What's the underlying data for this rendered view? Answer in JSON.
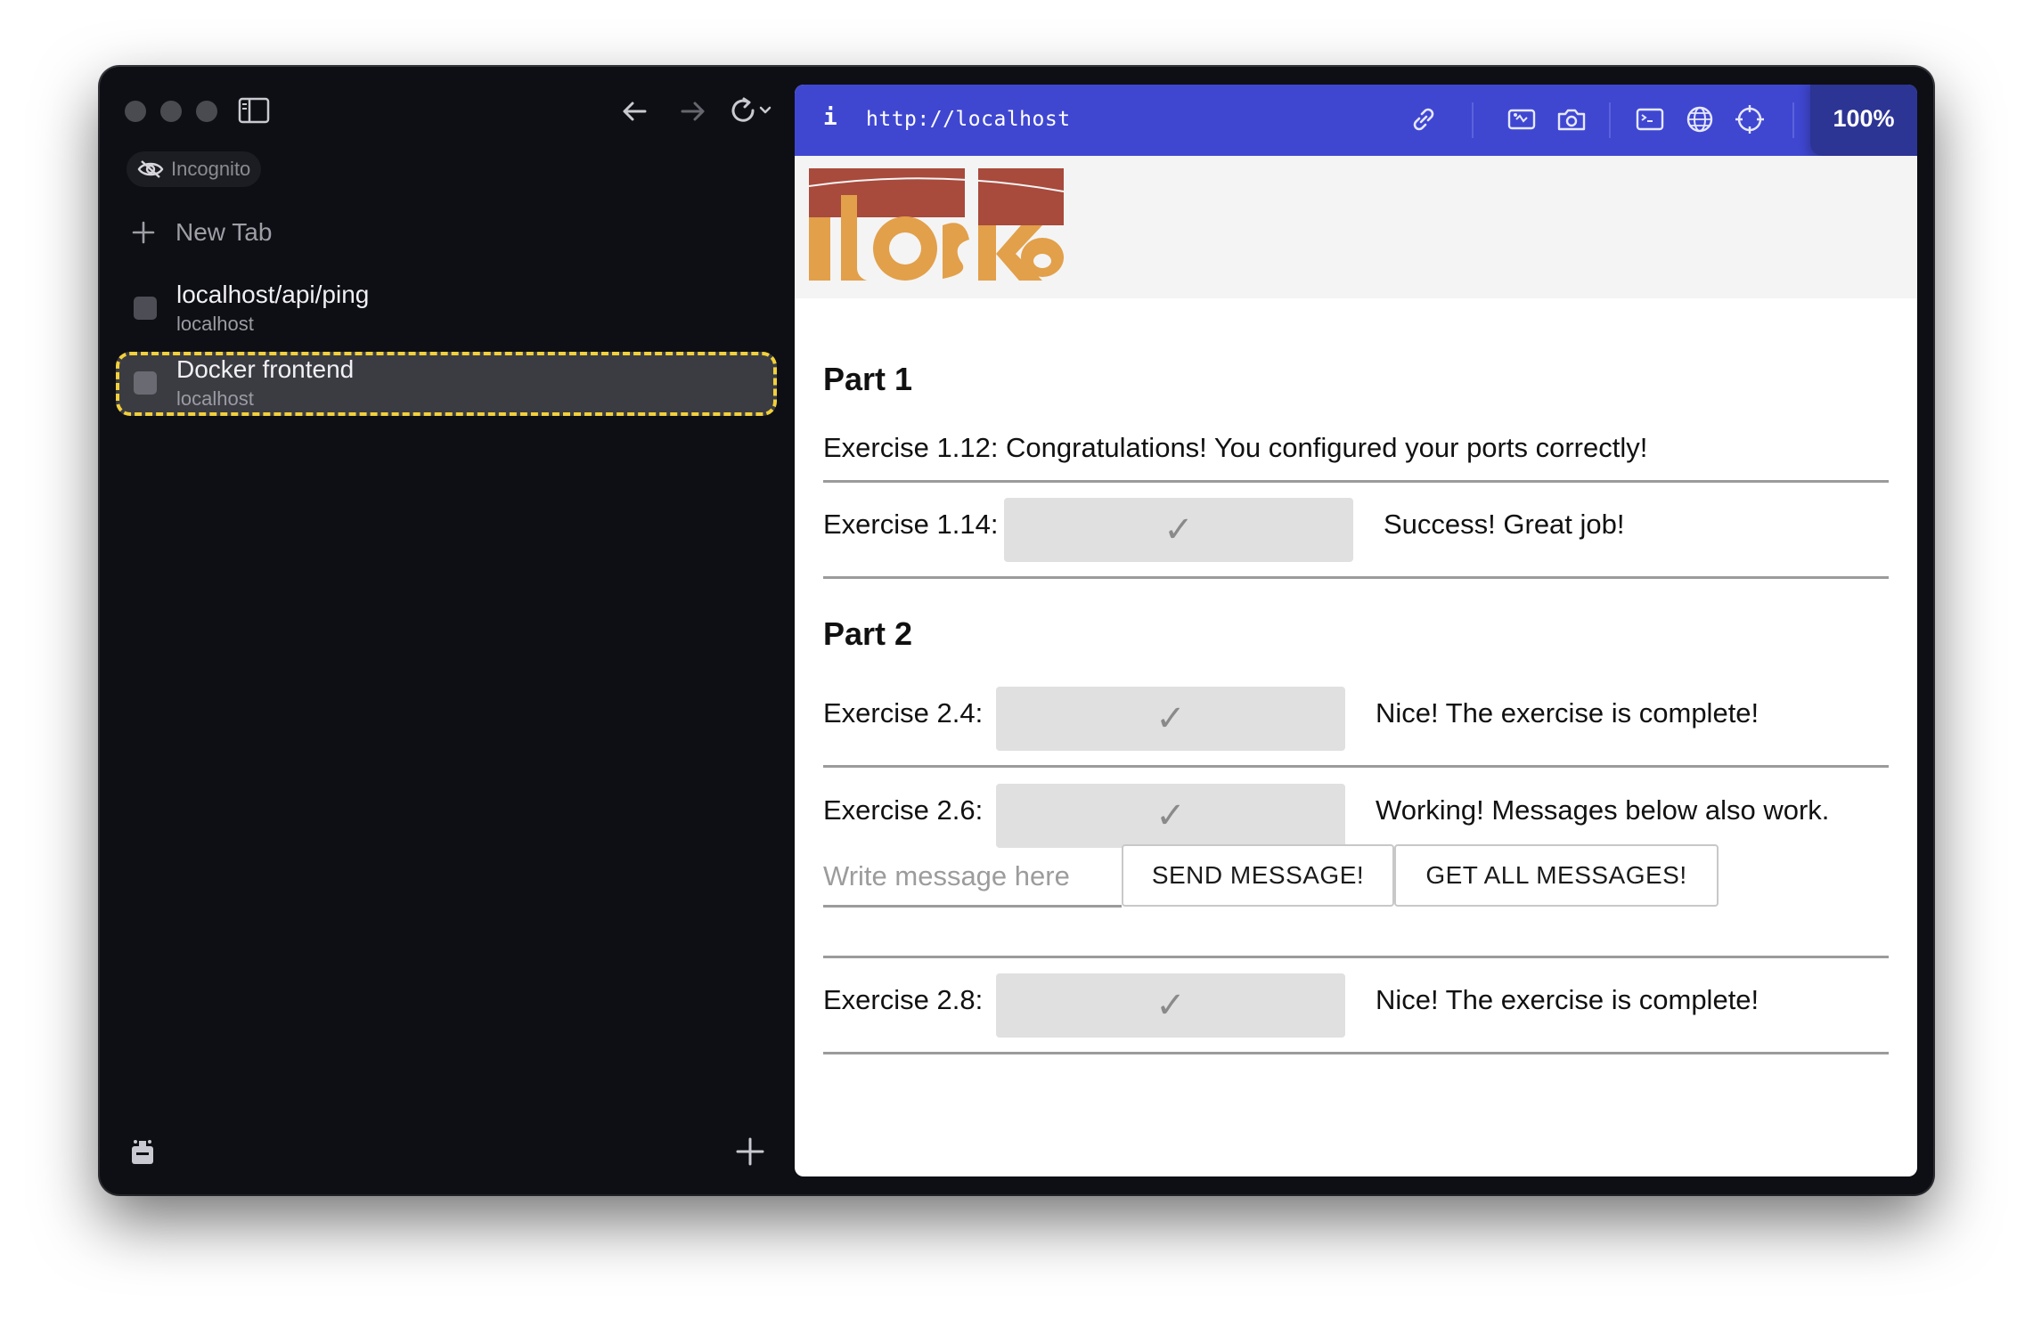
{
  "sidebar": {
    "incognito_label": "Incognito",
    "new_tab_label": "New Tab",
    "tabs": [
      {
        "title": "localhost/api/ping",
        "subtitle": "localhost"
      },
      {
        "title": "Docker frontend",
        "subtitle": "localhost"
      }
    ]
  },
  "toolbar": {
    "info_glyph": "i",
    "url": "http://localhost",
    "zoom": "100%",
    "accent_color": "#3f47d1"
  },
  "page": {
    "part1": {
      "title": "Part 1",
      "ex112": "Exercise 1.12: Congratulations! You configured your ports correctly!",
      "ex114_label": "Exercise 1.14:",
      "ex114_status": "Success! Great job!"
    },
    "part2": {
      "title": "Part 2",
      "ex24_label": "Exercise 2.4:",
      "ex24_status": "Nice! The exercise is complete!",
      "ex26_label": "Exercise 2.6:",
      "ex26_status": "Working! Messages below also work.",
      "message_placeholder": "Write message here",
      "send_label": "SEND MESSAGE!",
      "get_all_label": "GET ALL MESSAGES!",
      "ex28_label": "Exercise 2.8:",
      "ex28_status": "Nice! The exercise is complete!"
    },
    "check_glyph": "✓"
  }
}
